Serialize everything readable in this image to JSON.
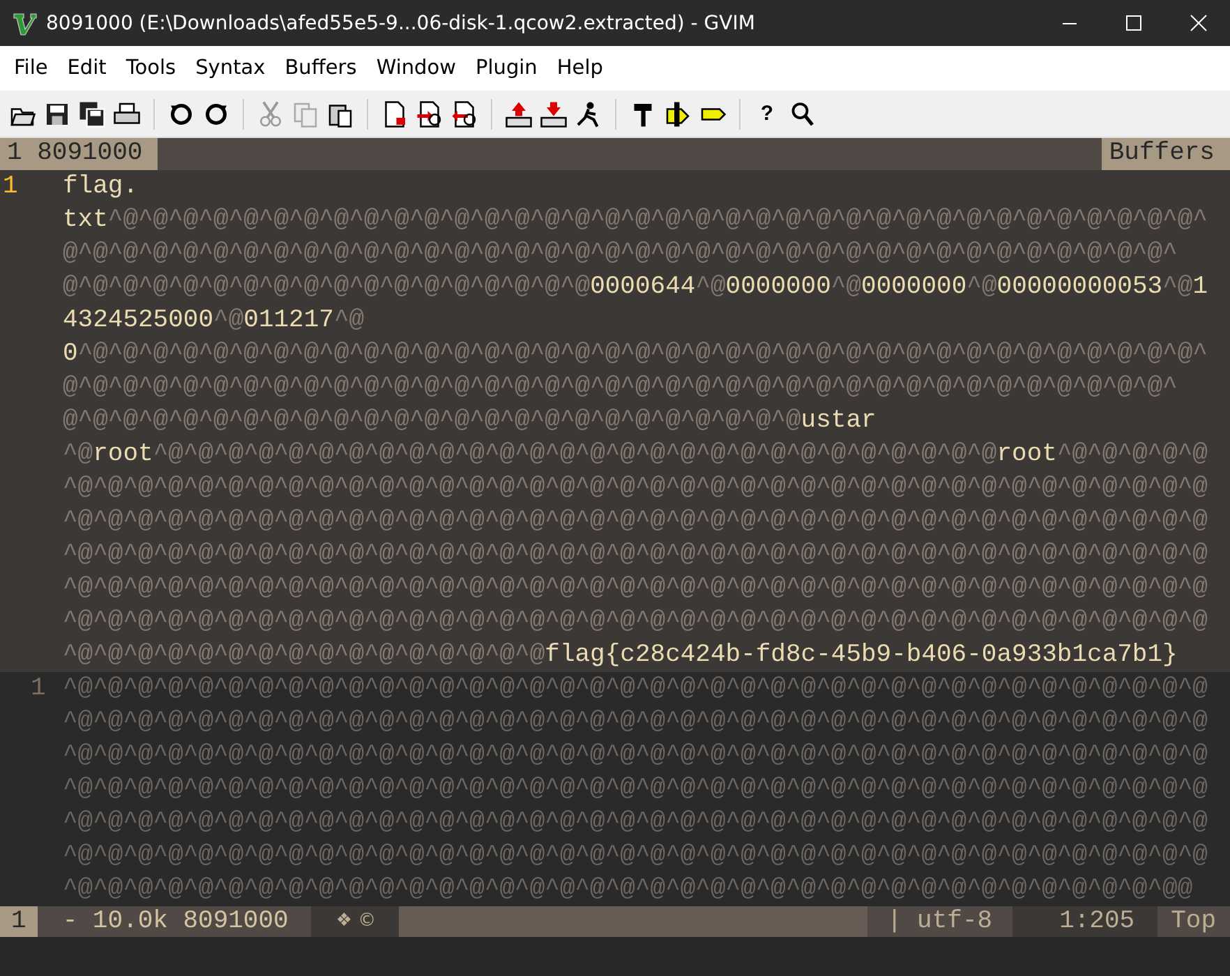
{
  "window": {
    "title": "8091000 (E:\\Downloads\\afed55e5-9...06-disk-1.qcow2.extracted) - GVIM"
  },
  "menu": [
    "File",
    "Edit",
    "Tools",
    "Syntax",
    "Buffers",
    "Window",
    "Plugin",
    "Help"
  ],
  "toolbar": {
    "help_glyph": "?"
  },
  "tabline": {
    "buffer": "1 8091000",
    "label": "Buffers"
  },
  "upper_window": {
    "active": true,
    "line_number": "1",
    "wrapped_lines": [
      [
        {
          "kind": "text",
          "text": "flag."
        }
      ],
      [
        {
          "kind": "text",
          "text": "txt"
        },
        {
          "kind": "ctrl",
          "text": "^@^@^@^@^@^@^@^@^@^@^@^@^@^@^@^@^@^@^@^@^@^@^@^@^@^@^@^@^@^@^@^@^@^@^@^@^"
        }
      ],
      [
        {
          "kind": "ctrl",
          "text": "@^@^@^@^@^@^@^@^@^@^@^@^@^@^@^@^@^@^@^@^@^@^@^@^@^@^@^@^@^@^@^@^@^@^@^@^@^"
        }
      ],
      [
        {
          "kind": "ctrl",
          "text": "@^@^@^@^@^@^@^@^@^@^@^@^@^@^@^@^@^@"
        },
        {
          "kind": "text",
          "text": "0000644"
        },
        {
          "kind": "ctrl",
          "text": "^@"
        },
        {
          "kind": "text",
          "text": "0000000"
        },
        {
          "kind": "ctrl",
          "text": "^@"
        },
        {
          "kind": "text",
          "text": "0000000"
        },
        {
          "kind": "ctrl",
          "text": "^@"
        },
        {
          "kind": "text",
          "text": "00000000053"
        },
        {
          "kind": "ctrl",
          "text": "^@"
        },
        {
          "kind": "text",
          "text": "1"
        }
      ],
      [
        {
          "kind": "text",
          "text": "4324525000"
        },
        {
          "kind": "ctrl",
          "text": "^@"
        },
        {
          "kind": "text",
          "text": "011217"
        },
        {
          "kind": "ctrl",
          "text": "^@"
        }
      ],
      [
        {
          "kind": "text",
          "text": "0"
        },
        {
          "kind": "ctrl",
          "text": "^@^@^@^@^@^@^@^@^@^@^@^@^@^@^@^@^@^@^@^@^@^@^@^@^@^@^@^@^@^@^@^@^@^@^@^@^@^"
        }
      ],
      [
        {
          "kind": "ctrl",
          "text": "@^@^@^@^@^@^@^@^@^@^@^@^@^@^@^@^@^@^@^@^@^@^@^@^@^@^@^@^@^@^@^@^@^@^@^@^@^"
        }
      ],
      [
        {
          "kind": "ctrl",
          "text": "@^@^@^@^@^@^@^@^@^@^@^@^@^@^@^@^@^@^@^@^@^@^@^@^@"
        },
        {
          "kind": "text",
          "text": "ustar"
        }
      ],
      [
        {
          "kind": "ctrl",
          "text": "^@"
        },
        {
          "kind": "text",
          "text": "root"
        },
        {
          "kind": "ctrl",
          "text": "^@^@^@^@^@^@^@^@^@^@^@^@^@^@^@^@^@^@^@^@^@^@^@^@^@^@^@^@"
        },
        {
          "kind": "text",
          "text": "root"
        },
        {
          "kind": "ctrl",
          "text": "^@^@^@^@^@"
        }
      ],
      [
        {
          "kind": "ctrl",
          "text": "^@^@^@^@^@^@^@^@^@^@^@^@^@^@^@^@^@^@^@^@^@^@^@^@^@^@^@^@^@^@^@^@^@^@^@^@^@^@"
        }
      ],
      [
        {
          "kind": "ctrl",
          "text": "^@^@^@^@^@^@^@^@^@^@^@^@^@^@^@^@^@^@^@^@^@^@^@^@^@^@^@^@^@^@^@^@^@^@^@^@^@^@"
        }
      ],
      [
        {
          "kind": "ctrl",
          "text": "^@^@^@^@^@^@^@^@^@^@^@^@^@^@^@^@^@^@^@^@^@^@^@^@^@^@^@^@^@^@^@^@^@^@^@^@^@^@"
        }
      ],
      [
        {
          "kind": "ctrl",
          "text": "^@^@^@^@^@^@^@^@^@^@^@^@^@^@^@^@^@^@^@^@^@^@^@^@^@^@^@^@^@^@^@^@^@^@^@^@^@^@"
        }
      ],
      [
        {
          "kind": "ctrl",
          "text": "^@^@^@^@^@^@^@^@^@^@^@^@^@^@^@^@^@^@^@^@^@^@^@^@^@^@^@^@^@^@^@^@^@^@^@^@^@^@"
        }
      ],
      [
        {
          "kind": "ctrl",
          "text": "^@^@^@^@^@^@^@^@^@^@^@^@^@^@^@^@"
        },
        {
          "kind": "text",
          "text": "flag{c28c424b-fd8c-45b9-b406-0a933b1ca7b1}"
        }
      ]
    ]
  },
  "lower_window": {
    "active": false,
    "line_number": "1",
    "wrapped_lines": [
      [
        {
          "kind": "ctrl",
          "text": "^@^@^@^@^@^@^@^@^@^@^@^@^@^@^@^@^@^@^@^@^@^@^@^@^@^@^@^@^@^@^@^@^@^@^@^@^@^@"
        }
      ],
      [
        {
          "kind": "ctrl",
          "text": "^@^@^@^@^@^@^@^@^@^@^@^@^@^@^@^@^@^@^@^@^@^@^@^@^@^@^@^@^@^@^@^@^@^@^@^@^@^@"
        }
      ],
      [
        {
          "kind": "ctrl",
          "text": "^@^@^@^@^@^@^@^@^@^@^@^@^@^@^@^@^@^@^@^@^@^@^@^@^@^@^@^@^@^@^@^@^@^@^@^@^@^@"
        }
      ],
      [
        {
          "kind": "ctrl",
          "text": "^@^@^@^@^@^@^@^@^@^@^@^@^@^@^@^@^@^@^@^@^@^@^@^@^@^@^@^@^@^@^@^@^@^@^@^@^@^@"
        }
      ],
      [
        {
          "kind": "ctrl",
          "text": "^@^@^@^@^@^@^@^@^@^@^@^@^@^@^@^@^@^@^@^@^@^@^@^@^@^@^@^@^@^@^@^@^@^@^@^@^@^@"
        }
      ],
      [
        {
          "kind": "ctrl",
          "text": "^@^@^@^@^@^@^@^@^@^@^@^@^@^@^@^@^@^@^@^@^@^@^@^@^@^@^@^@^@^@^@^@^@^@^@^@^@^@"
        }
      ],
      [
        {
          "kind": "ctrl",
          "text": "^@^@^@^@^@^@^@^@^@^@^@^@^@^@^@^@^@^@^@^@^@^@^@^@^@^@^@^@^@^@^@^@^@^@^@^@^@@"
        }
      ]
    ]
  },
  "status_line": [
    {
      "kind": "mode",
      "text": "1"
    },
    {
      "kind": "file",
      "text": "- 10.0k 8091000"
    },
    {
      "kind": "flags",
      "text": "❖ ©"
    },
    {
      "kind": "fill"
    },
    {
      "kind": "encoding",
      "text": "| utf-8"
    },
    {
      "kind": "position",
      "text": "1:205"
    },
    {
      "kind": "scroll",
      "text": "Top"
    }
  ]
}
